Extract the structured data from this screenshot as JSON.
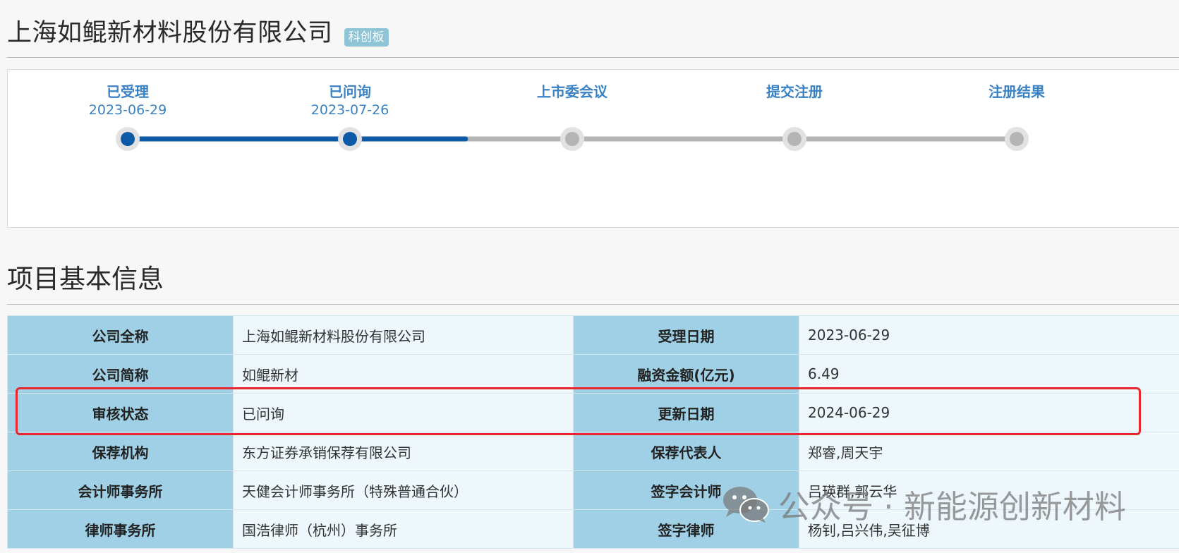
{
  "header": {
    "company_title": "上海如鲲新材料股份有限公司",
    "board_badge": "科创板"
  },
  "progress": {
    "completed_fraction": 0.38,
    "steps": [
      {
        "label": "已受理",
        "date": "2023-06-29",
        "done": true
      },
      {
        "label": "已问询",
        "date": "2023-07-26",
        "done": true
      },
      {
        "label": "上市委会议",
        "date": "",
        "done": false
      },
      {
        "label": "提交注册",
        "date": "",
        "done": false
      },
      {
        "label": "注册结果",
        "date": "",
        "done": false
      }
    ],
    "colors": {
      "active": "#0d5aa6",
      "inactive": "#b4b4b4",
      "halo": "#e2e2e2"
    }
  },
  "section": {
    "title": "项目基本信息"
  },
  "info_rows": [
    {
      "k1": "公司全称",
      "v1": "上海如鲲新材料股份有限公司",
      "k2": "受理日期",
      "v2": "2023-06-29"
    },
    {
      "k1": "公司简称",
      "v1": "如鲲新材",
      "k2": "融资金额(亿元)",
      "v2": "6.49"
    },
    {
      "k1": "审核状态",
      "v1": "已问询",
      "k2": "更新日期",
      "v2": "2024-06-29"
    },
    {
      "k1": "保荐机构",
      "v1": "东方证券承销保荐有限公司",
      "k2": "保荐代表人",
      "v2": "郑睿,周天宇"
    },
    {
      "k1": "会计师事务所",
      "v1": "天健会计师事务所（特殊普通合伙）",
      "k2": "签字会计师",
      "v2": "吕瑛群,郭云华"
    },
    {
      "k1": "律师事务所",
      "v1": "国浩律师（杭州）事务所",
      "k2": "签字律师",
      "v2": "杨钊,吕兴伟,吴征博"
    }
  ],
  "watermark": {
    "text": "公众号 · 新能源创新材料",
    "icon": "wechat-icon"
  },
  "highlight_color": "#e8262b"
}
